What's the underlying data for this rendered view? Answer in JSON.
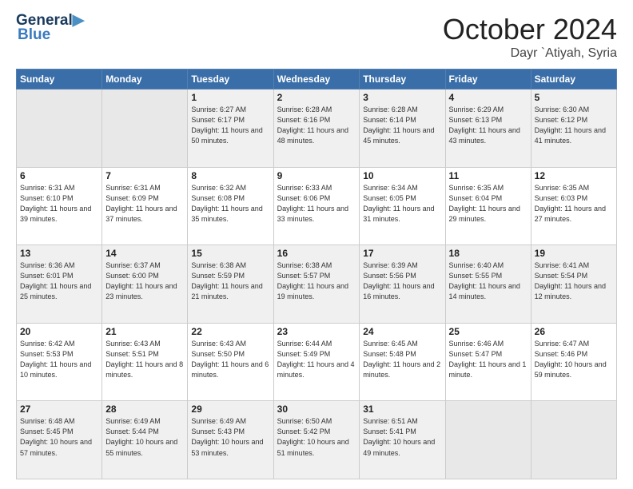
{
  "header": {
    "logo_line1": "General",
    "logo_line2": "Blue",
    "title": "October 2024",
    "location": "Dayr `Atiyah, Syria"
  },
  "weekdays": [
    "Sunday",
    "Monday",
    "Tuesday",
    "Wednesday",
    "Thursday",
    "Friday",
    "Saturday"
  ],
  "weeks": [
    [
      {
        "day": "",
        "details": ""
      },
      {
        "day": "",
        "details": ""
      },
      {
        "day": "1",
        "details": "Sunrise: 6:27 AM\nSunset: 6:17 PM\nDaylight: 11 hours and 50 minutes."
      },
      {
        "day": "2",
        "details": "Sunrise: 6:28 AM\nSunset: 6:16 PM\nDaylight: 11 hours and 48 minutes."
      },
      {
        "day": "3",
        "details": "Sunrise: 6:28 AM\nSunset: 6:14 PM\nDaylight: 11 hours and 45 minutes."
      },
      {
        "day": "4",
        "details": "Sunrise: 6:29 AM\nSunset: 6:13 PM\nDaylight: 11 hours and 43 minutes."
      },
      {
        "day": "5",
        "details": "Sunrise: 6:30 AM\nSunset: 6:12 PM\nDaylight: 11 hours and 41 minutes."
      }
    ],
    [
      {
        "day": "6",
        "details": "Sunrise: 6:31 AM\nSunset: 6:10 PM\nDaylight: 11 hours and 39 minutes."
      },
      {
        "day": "7",
        "details": "Sunrise: 6:31 AM\nSunset: 6:09 PM\nDaylight: 11 hours and 37 minutes."
      },
      {
        "day": "8",
        "details": "Sunrise: 6:32 AM\nSunset: 6:08 PM\nDaylight: 11 hours and 35 minutes."
      },
      {
        "day": "9",
        "details": "Sunrise: 6:33 AM\nSunset: 6:06 PM\nDaylight: 11 hours and 33 minutes."
      },
      {
        "day": "10",
        "details": "Sunrise: 6:34 AM\nSunset: 6:05 PM\nDaylight: 11 hours and 31 minutes."
      },
      {
        "day": "11",
        "details": "Sunrise: 6:35 AM\nSunset: 6:04 PM\nDaylight: 11 hours and 29 minutes."
      },
      {
        "day": "12",
        "details": "Sunrise: 6:35 AM\nSunset: 6:03 PM\nDaylight: 11 hours and 27 minutes."
      }
    ],
    [
      {
        "day": "13",
        "details": "Sunrise: 6:36 AM\nSunset: 6:01 PM\nDaylight: 11 hours and 25 minutes."
      },
      {
        "day": "14",
        "details": "Sunrise: 6:37 AM\nSunset: 6:00 PM\nDaylight: 11 hours and 23 minutes."
      },
      {
        "day": "15",
        "details": "Sunrise: 6:38 AM\nSunset: 5:59 PM\nDaylight: 11 hours and 21 minutes."
      },
      {
        "day": "16",
        "details": "Sunrise: 6:38 AM\nSunset: 5:57 PM\nDaylight: 11 hours and 19 minutes."
      },
      {
        "day": "17",
        "details": "Sunrise: 6:39 AM\nSunset: 5:56 PM\nDaylight: 11 hours and 16 minutes."
      },
      {
        "day": "18",
        "details": "Sunrise: 6:40 AM\nSunset: 5:55 PM\nDaylight: 11 hours and 14 minutes."
      },
      {
        "day": "19",
        "details": "Sunrise: 6:41 AM\nSunset: 5:54 PM\nDaylight: 11 hours and 12 minutes."
      }
    ],
    [
      {
        "day": "20",
        "details": "Sunrise: 6:42 AM\nSunset: 5:53 PM\nDaylight: 11 hours and 10 minutes."
      },
      {
        "day": "21",
        "details": "Sunrise: 6:43 AM\nSunset: 5:51 PM\nDaylight: 11 hours and 8 minutes."
      },
      {
        "day": "22",
        "details": "Sunrise: 6:43 AM\nSunset: 5:50 PM\nDaylight: 11 hours and 6 minutes."
      },
      {
        "day": "23",
        "details": "Sunrise: 6:44 AM\nSunset: 5:49 PM\nDaylight: 11 hours and 4 minutes."
      },
      {
        "day": "24",
        "details": "Sunrise: 6:45 AM\nSunset: 5:48 PM\nDaylight: 11 hours and 2 minutes."
      },
      {
        "day": "25",
        "details": "Sunrise: 6:46 AM\nSunset: 5:47 PM\nDaylight: 11 hours and 1 minute."
      },
      {
        "day": "26",
        "details": "Sunrise: 6:47 AM\nSunset: 5:46 PM\nDaylight: 10 hours and 59 minutes."
      }
    ],
    [
      {
        "day": "27",
        "details": "Sunrise: 6:48 AM\nSunset: 5:45 PM\nDaylight: 10 hours and 57 minutes."
      },
      {
        "day": "28",
        "details": "Sunrise: 6:49 AM\nSunset: 5:44 PM\nDaylight: 10 hours and 55 minutes."
      },
      {
        "day": "29",
        "details": "Sunrise: 6:49 AM\nSunset: 5:43 PM\nDaylight: 10 hours and 53 minutes."
      },
      {
        "day": "30",
        "details": "Sunrise: 6:50 AM\nSunset: 5:42 PM\nDaylight: 10 hours and 51 minutes."
      },
      {
        "day": "31",
        "details": "Sunrise: 6:51 AM\nSunset: 5:41 PM\nDaylight: 10 hours and 49 minutes."
      },
      {
        "day": "",
        "details": ""
      },
      {
        "day": "",
        "details": ""
      }
    ]
  ]
}
